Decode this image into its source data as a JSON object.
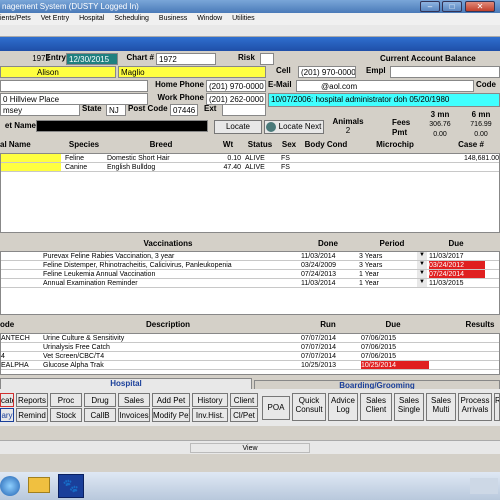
{
  "window": {
    "title": "nagement System (DUSTY Logged In)",
    "controls": [
      "–",
      "□",
      "✕"
    ]
  },
  "menu": [
    "ients/Pets",
    "Vet Entry",
    "Hospital",
    "Scheduling",
    "Business",
    "Window",
    "Utilities"
  ],
  "client": {
    "id": "1972",
    "entry_label": "Entry",
    "entry_date": "12/30/2015",
    "chart_label": "Chart #",
    "chart_num": "1972",
    "risk_label": "Risk",
    "first_name": "Alison",
    "last_name": "Maglio",
    "cell_label": "Cell",
    "cell": "(201) 970-0000",
    "empl_label": "Empl",
    "acct_balance_label": "Current Account Balance",
    "home_label": "Home Phone",
    "home": "(201) 970-0000",
    "email_label": "E-Mail",
    "email": "@aol.com",
    "code_label": "Code",
    "address": "Hillview Place",
    "address_num": "0",
    "work_label": "Work Phone",
    "work": "(201) 262-0000",
    "note": "10/07/2006: hospital administrator  doh  05/20/1980",
    "city": "msey",
    "state_label": "State",
    "state": "NJ",
    "post_label": "Post Code",
    "post": "07446",
    "ext_label": "Ext",
    "pet_name_label": "et Name",
    "locate": "Locate",
    "locate_next": "Locate Next",
    "animals_label": "Animals",
    "animals": "2",
    "fees_label": "Fees",
    "pmt_label": "Pmt",
    "m3_label": "3 mn",
    "m6_label": "6 mn",
    "m3_fees": "306.76",
    "m6_fees": "716.99",
    "m3_pmt": "0.00",
    "m6_pmt": "0.00"
  },
  "pets": {
    "headers": [
      "al Name",
      "Species",
      "Breed",
      "Wt",
      "Status",
      "Sex",
      "Body Cond",
      "Microchip",
      "Case #"
    ],
    "rows": [
      {
        "species": "Feline",
        "breed": "Domestic Short Hair",
        "wt": "0.10",
        "status": "ALIVE",
        "sex": "FS",
        "case": "148,681.00"
      },
      {
        "species": "Canine",
        "breed": "English Bulldog",
        "wt": "47.40",
        "status": "ALIVE",
        "sex": "FS",
        "case": ""
      }
    ]
  },
  "vaccinations": {
    "headers": [
      "Vaccinations",
      "Done",
      "Period",
      "Due"
    ],
    "rows": [
      {
        "name": "Purevax Feline Rabies Vaccination, 3 year",
        "done": "11/03/2014",
        "period": "3 Years",
        "due": "11/03/2017",
        "overdue": false
      },
      {
        "name": "Feline Distemper, Rhinotracheitis, Calicivirus, Panleukopenia",
        "done": "03/24/2009",
        "period": "3 Years",
        "due": "03/24/2012",
        "overdue": true
      },
      {
        "name": "Feline Leukemia Annual Vaccination",
        "done": "07/24/2013",
        "period": "1 Year",
        "due": "07/24/2014",
        "overdue": true
      },
      {
        "name": "Annual Examination Reminder",
        "done": "11/03/2014",
        "period": "1 Year",
        "due": "11/03/2015",
        "overdue": false
      }
    ]
  },
  "labs": {
    "headers": [
      "ode",
      "Description",
      "Run",
      "Due",
      "Results"
    ],
    "rows": [
      {
        "code": "ANTECH",
        "desc": "Urine Culture & Sensitivity",
        "run": "07/07/2014",
        "due": "07/06/2015",
        "overdue": false
      },
      {
        "code": "",
        "desc": "Urinalysis Free Catch",
        "run": "07/07/2014",
        "due": "07/06/2015",
        "overdue": false
      },
      {
        "code": "4",
        "desc": "Vet Screen/CBC/T4",
        "run": "07/07/2014",
        "due": "07/06/2015",
        "overdue": false
      },
      {
        "code": "EALPHA",
        "desc": "Glucose Alpha Trak",
        "run": "10/25/2013",
        "due": "10/25/2014",
        "overdue": true
      }
    ]
  },
  "tabs": {
    "hospital": "Hospital",
    "boarding": "Boarding/Grooming"
  },
  "buttons": {
    "row1": [
      "cate",
      "Reports",
      "Proc",
      "Drug",
      "Sales",
      "Add Pet",
      "History",
      "Client"
    ],
    "row2": [
      "ary",
      "Remind",
      "Stock",
      "CallB",
      "Invoices",
      "Modify Pet",
      "Inv.Hist.",
      "Cl/Pet"
    ],
    "big": [
      "POA",
      "Quick Consult",
      "Advice Log",
      "Sales Client",
      "Sales Single",
      "Sales Multi",
      "Process Arrivals",
      "Re"
    ]
  },
  "status": {
    "view": "View"
  }
}
